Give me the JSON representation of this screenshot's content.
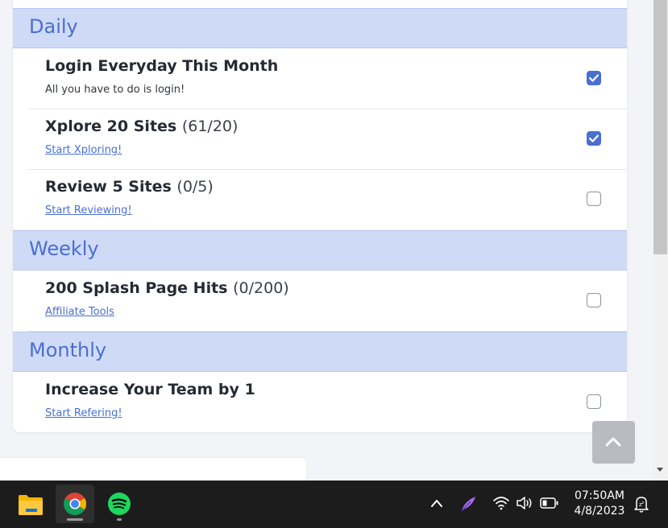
{
  "sections": [
    {
      "title": "Daily",
      "tasks": [
        {
          "title": "Login Everyday This Month",
          "count": "",
          "subtitle": "All you have to do is login!",
          "link": "",
          "checked": true
        },
        {
          "title": "Xplore 20 Sites",
          "count": "(61/20)",
          "subtitle": "",
          "link": "Start Xploring!",
          "checked": true
        },
        {
          "title": "Review 5 Sites",
          "count": "(0/5)",
          "subtitle": "",
          "link": "Start Reviewing!",
          "checked": false
        }
      ]
    },
    {
      "title": "Weekly",
      "tasks": [
        {
          "title": "200 Splash Page Hits",
          "count": "(0/200)",
          "subtitle": "",
          "link": "Affiliate Tools",
          "checked": false
        }
      ]
    },
    {
      "title": "Monthly",
      "tasks": [
        {
          "title": "Increase Your Team by 1",
          "count": "",
          "subtitle": "",
          "link": "Start Refering!",
          "checked": false
        }
      ]
    }
  ],
  "colors": {
    "accent": "#4a6fd0",
    "section_bg": "#cfdaf6",
    "taskbar_bg": "#1c1c1c"
  },
  "taskbar": {
    "apps": [
      {
        "name": "file-explorer-icon",
        "active": false
      },
      {
        "name": "chrome-icon",
        "active": true
      },
      {
        "name": "spotify-icon",
        "active": false
      }
    ],
    "tray_icons": [
      "chevron-up-icon",
      "feather-icon",
      "wifi-icon",
      "volume-icon",
      "battery-icon"
    ],
    "time": "07:50AM",
    "date": "4/8/2023"
  }
}
